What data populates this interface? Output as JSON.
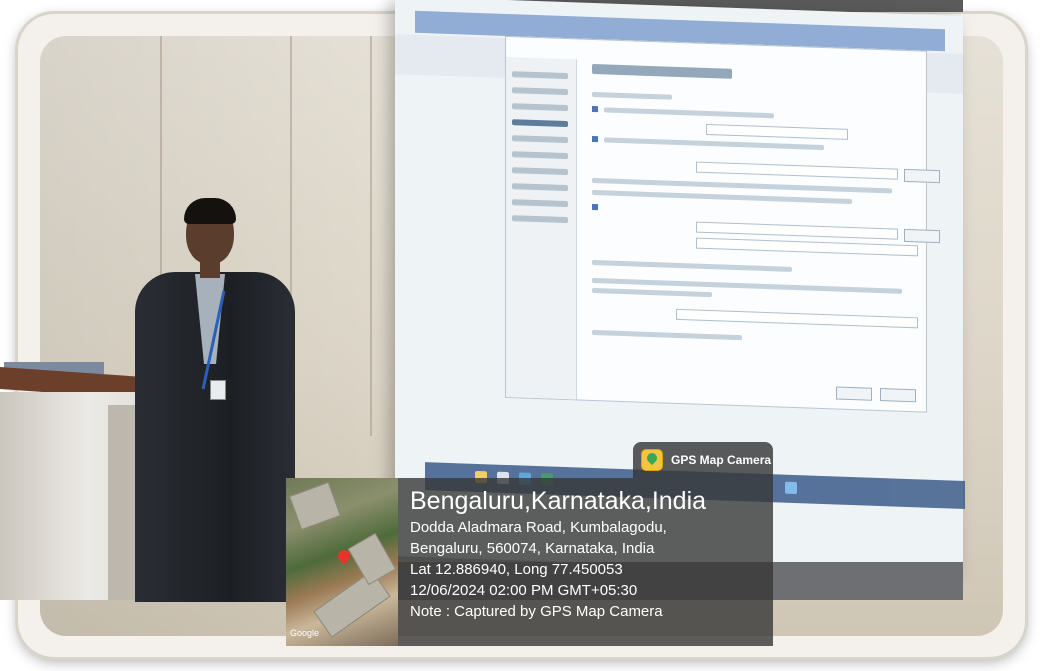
{
  "gps_overlay": {
    "app_name": "GPS Map Camera",
    "city_line": "Bengaluru,Karnataka,India",
    "address_line_1": "Dodda Aladmara Road, Kumbalagodu,",
    "address_line_2": "Bengaluru, 560074, Karnataka, India",
    "coordinates": "Lat 12.886940, Long 77.450053",
    "datetime": "12/06/2024 02:00 PM GMT+05:30",
    "note": "Note : Captured by GPS Map Camera",
    "map_brand": "Google",
    "logo_icon": "gps-map-camera-logo-icon",
    "pin_icon": "map-pin-icon"
  },
  "colors": {
    "overlay_background": "#373737",
    "overlay_text": "#ffffff",
    "map_pin": "#e8352b",
    "screen_background": "#eef3f6"
  }
}
